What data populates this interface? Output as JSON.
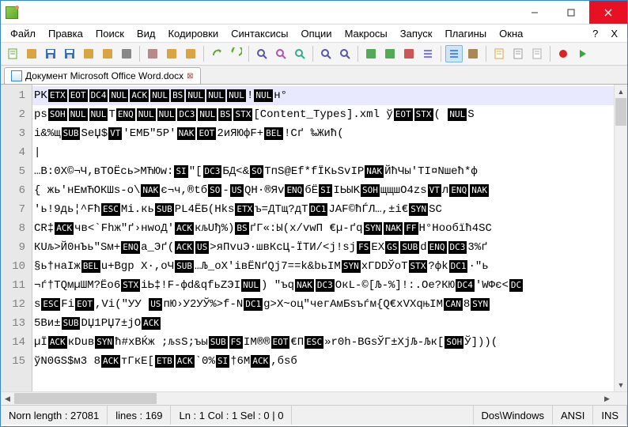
{
  "menus": [
    "Файл",
    "Правка",
    "Поиск",
    "Вид",
    "Кодировки",
    "Синтаксисы",
    "Опции",
    "Макросы",
    "Запуск",
    "Плагины",
    "Окна",
    "?",
    "X"
  ],
  "tab": {
    "label": "Документ Microsoft Office Word.docx"
  },
  "lines": [
    {
      "n": 1,
      "hl": true,
      "segs": [
        [
          "t",
          "PK"
        ],
        [
          "c",
          "ETX"
        ],
        [
          "c",
          "EOT"
        ],
        [
          "c",
          "DC4"
        ],
        [
          "c",
          "NUL"
        ],
        [
          "c",
          "ACK"
        ],
        [
          "c",
          "NUL"
        ],
        [
          "c",
          "BS"
        ],
        [
          "c",
          "NUL"
        ],
        [
          "c",
          "NUL"
        ],
        [
          "c",
          "NUL"
        ],
        [
          "t",
          "!"
        ],
        [
          "c",
          "NUL"
        ],
        [
          "t",
          "н°"
        ]
      ]
    },
    {
      "n": 2,
      "segs": [
        [
          "t",
          "ps"
        ],
        [
          "c",
          "SOH"
        ],
        [
          "c",
          "NUL"
        ],
        [
          "c",
          "NUL"
        ],
        [
          "t",
          "T"
        ],
        [
          "c",
          "ENQ"
        ],
        [
          "c",
          "NUL"
        ],
        [
          "c",
          "NUL"
        ],
        [
          "c",
          "DC3"
        ],
        [
          "c",
          "NUL"
        ],
        [
          "c",
          "BS"
        ],
        [
          "c",
          "STX"
        ],
        [
          "t",
          "[Content_Types].xml ў"
        ],
        [
          "c",
          "EOT"
        ],
        [
          "c",
          "STX"
        ],
        [
          "t",
          "( "
        ],
        [
          "c",
          "NUL"
        ],
        [
          "t",
          "S"
        ]
      ]
    },
    {
      "n": 3,
      "segs": [
        [
          "t",
          "i&%щ"
        ],
        [
          "c",
          "SUB"
        ],
        [
          "t",
          "SeЏ$"
        ],
        [
          "c",
          "VT"
        ],
        [
          "t",
          "'EMБ\"5P'"
        ],
        [
          "c",
          "NAK"
        ],
        [
          "c",
          "EOT"
        ],
        [
          "t",
          "2иЯЮфF+"
        ],
        [
          "c",
          "BEL"
        ],
        [
          "t",
          "!Cґ  ‰Жиħ("
        ]
      ]
    },
    {
      "n": 4,
      "segs": [
        [
          "t",
          "|"
        ]
      ]
    },
    {
      "n": 5,
      "segs": [
        [
          "t",
          "…В:0X©¬Ч,вТОЁсь>МЋЮw:"
        ],
        [
          "c",
          "SI"
        ],
        [
          "t",
          "\"["
        ],
        [
          "c",
          "DC3"
        ],
        [
          "t",
          "БД<&"
        ],
        [
          "c",
          "SO"
        ],
        [
          "t",
          "TпS@Ef*fЇКьSvIP"
        ],
        [
          "c",
          "NAK"
        ],
        [
          "t",
          "ЙħЧы'TІ¤Nшeħ*ф"
        ]
      ]
    },
    {
      "n": 6,
      "segs": [
        [
          "t",
          "{ жь'нЕмЋОКШs-о\\"
        ],
        [
          "c",
          "NAK"
        ],
        [
          "t",
          "є¬ч,®tб"
        ],
        [
          "c",
          "SO"
        ],
        [
          "t",
          "-"
        ],
        [
          "c",
          "US"
        ],
        [
          "t",
          "QH·®Яv"
        ],
        [
          "c",
          "ENQ"
        ],
        [
          "t",
          "бЁ"
        ],
        [
          "c",
          "SI"
        ],
        [
          "t",
          "ІЬЫK"
        ],
        [
          "c",
          "SOH"
        ],
        [
          "t",
          "щщшO4zs"
        ],
        [
          "c",
          "VT"
        ],
        [
          "t",
          "л"
        ],
        [
          "c",
          "ENQ"
        ],
        [
          "c",
          "NAK"
        ]
      ]
    },
    {
      "n": 7,
      "segs": [
        [
          "t",
          "'ь!9дь¦^Fħ"
        ],
        [
          "c",
          "ESC"
        ],
        [
          "t",
          "Mi.кь"
        ],
        [
          "c",
          "SUB"
        ],
        [
          "t",
          "PL4ЁБ(Hks"
        ],
        [
          "c",
          "ETX"
        ],
        [
          "t",
          "ъ=ДТщ?дТ"
        ],
        [
          "c",
          "DC1"
        ],
        [
          "t",
          "JAF©ћЃЛ…,±i€"
        ],
        [
          "c",
          "SYN"
        ],
        [
          "t",
          "SC"
        ]
      ]
    },
    {
      "n": 8,
      "segs": [
        [
          "t",
          "CR‡"
        ],
        [
          "c",
          "ACK"
        ],
        [
          "t",
          "чв<`Fhж\"ґ›нwоД'"
        ],
        [
          "c",
          "ACK"
        ],
        [
          "t",
          "кљUђ%)"
        ],
        [
          "c",
          "BS"
        ],
        [
          "t",
          "ґГ«:Ы(x/vwП €µ-ґq"
        ],
        [
          "c",
          "SYN"
        ],
        [
          "c",
          "NAK"
        ],
        [
          "c",
          "FF"
        ],
        [
          "t",
          "Н°Hooбїħ4SC"
        ]
      ]
    },
    {
      "n": 9,
      "segs": [
        [
          "t",
          "КUљ>Й0нЪь\"Sм+"
        ],
        [
          "c",
          "ENQ"
        ],
        [
          "t",
          "a_Эґ("
        ],
        [
          "c",
          "ACK"
        ],
        [
          "c",
          "US"
        ],
        [
          "t",
          ">яПvuЭ·швКсЦ-ЇТИ/<j!sj"
        ],
        [
          "c",
          "FS"
        ],
        [
          "t",
          "EX"
        ],
        [
          "c",
          "GS"
        ],
        [
          "c",
          "SUB"
        ],
        [
          "t",
          "d"
        ],
        [
          "c",
          "ENQ"
        ],
        [
          "c",
          "DC3"
        ],
        [
          "t",
          "3%ґ"
        ]
      ]
    },
    {
      "n": 10,
      "segs": [
        [
          "t",
          "§ь†наІж"
        ],
        [
          "c",
          "BEL"
        ],
        [
          "t",
          "u+Bgp X·,oЧ"
        ],
        [
          "c",
          "SUB"
        ],
        [
          "t",
          "…Љ_oX'iвЁNґQj7==k&bьІM"
        ],
        [
          "c",
          "SYN"
        ],
        [
          "t",
          "xГDDЎoT"
        ],
        [
          "c",
          "STX"
        ],
        [
          "t",
          "?фk"
        ],
        [
          "c",
          "DC1"
        ],
        [
          "t",
          "·\"ь"
        ]
      ]
    },
    {
      "n": 11,
      "segs": [
        [
          "t",
          "¬ѓ†ТQмµШМ?Ёо6"
        ],
        [
          "c",
          "STX"
        ],
        [
          "t",
          "іЬ‡!F-фd&qfьZЭI"
        ],
        [
          "c",
          "NUL"
        ],
        [
          "t",
          ") \"ъq"
        ],
        [
          "c",
          "NAK"
        ],
        [
          "c",
          "DC3"
        ],
        [
          "t",
          "ОкL-©[Љ-%]!:.Oе?КЮ"
        ],
        [
          "c",
          "DC4"
        ],
        [
          "t",
          "'WФє<"
        ],
        [
          "c",
          "DC"
        ]
      ]
    },
    {
      "n": 12,
      "segs": [
        [
          "t",
          "s"
        ],
        [
          "c",
          "ESC"
        ],
        [
          "t",
          "Fi"
        ],
        [
          "c",
          "EOT"
        ],
        [
          "t",
          ",Vi(\"УУ "
        ],
        [
          "c",
          "US"
        ],
        [
          "t",
          "пЮ›У2УЎ%>f-N"
        ],
        [
          "c",
          "DC1"
        ],
        [
          "t",
          "g>X~oц\"чегАмБsъѓм{Q€xVXqњIM"
        ],
        [
          "c",
          "CAN"
        ],
        [
          "t",
          "8"
        ],
        [
          "c",
          "SYN"
        ]
      ]
    },
    {
      "n": 13,
      "segs": [
        [
          "t",
          "5Bи±"
        ],
        [
          "c",
          "SUB"
        ],
        [
          "t",
          "DЏ1РЏ7±jО"
        ],
        [
          "c",
          "ACK"
        ]
      ]
    },
    {
      "n": 14,
      "segs": [
        [
          "t",
          "µЇ"
        ],
        [
          "c",
          "ACK"
        ],
        [
          "t",
          "кDuв"
        ],
        [
          "c",
          "SYN"
        ],
        [
          "t",
          "ħ#xBЌж ;љsS;ъы"
        ],
        [
          "c",
          "SUB"
        ],
        [
          "c",
          "FS"
        ],
        [
          "t",
          "ІM®®"
        ],
        [
          "c",
          "EOT"
        ],
        [
          "t",
          "€П"
        ],
        [
          "c",
          "ESC"
        ],
        [
          "t",
          "»r0h-BGsЎГ±XjЉ-Љк["
        ],
        [
          "c",
          "SOH"
        ],
        [
          "t",
          "Ў]))("
        ]
      ]
    },
    {
      "n": 15,
      "segs": [
        [
          "t",
          "ўN0GS$м3 8"
        ],
        [
          "c",
          "ACK"
        ],
        [
          "t",
          "тГкE["
        ],
        [
          "c",
          "ETB"
        ],
        [
          "c",
          "ACK"
        ],
        [
          "t",
          "`0%"
        ],
        [
          "c",
          "SI"
        ],
        [
          "t",
          "†6M"
        ],
        [
          "c",
          "ACK"
        ],
        [
          "t",
          ",бsб"
        ]
      ]
    }
  ],
  "status": {
    "length_label": "Norn length : 27081",
    "lines_label": "lines : 169",
    "pos": "Ln : 1   Col : 1   Sel : 0 | 0",
    "eol": "Dos\\Windows",
    "enc": "ANSI",
    "mode": "INS"
  },
  "icons": {
    "new": "#5fa82f",
    "open": "#d9a441",
    "save": "#3a6fb7",
    "saveall": "#3a6fb7",
    "close": "#d9a441",
    "closeall": "#d9a441",
    "print": "#888",
    "cut": "#b88",
    "copy": "#d9a441",
    "paste": "#d9a441",
    "undo": "#5fa82f",
    "redo": "#5fa82f",
    "find": "#55a",
    "replace": "#a5a",
    "findfiles": "#3a8",
    "zoomin": "#55a",
    "zoomout": "#55a",
    "sync": "#5a5",
    "wrap": "#c55",
    "allchars": "#77f",
    "indent": "#58e",
    "lang": "#a85",
    "folder": "#d9a441",
    "doc": "#999",
    "func": "#aaa",
    "rec": "#d22",
    "play": "#3a3"
  }
}
